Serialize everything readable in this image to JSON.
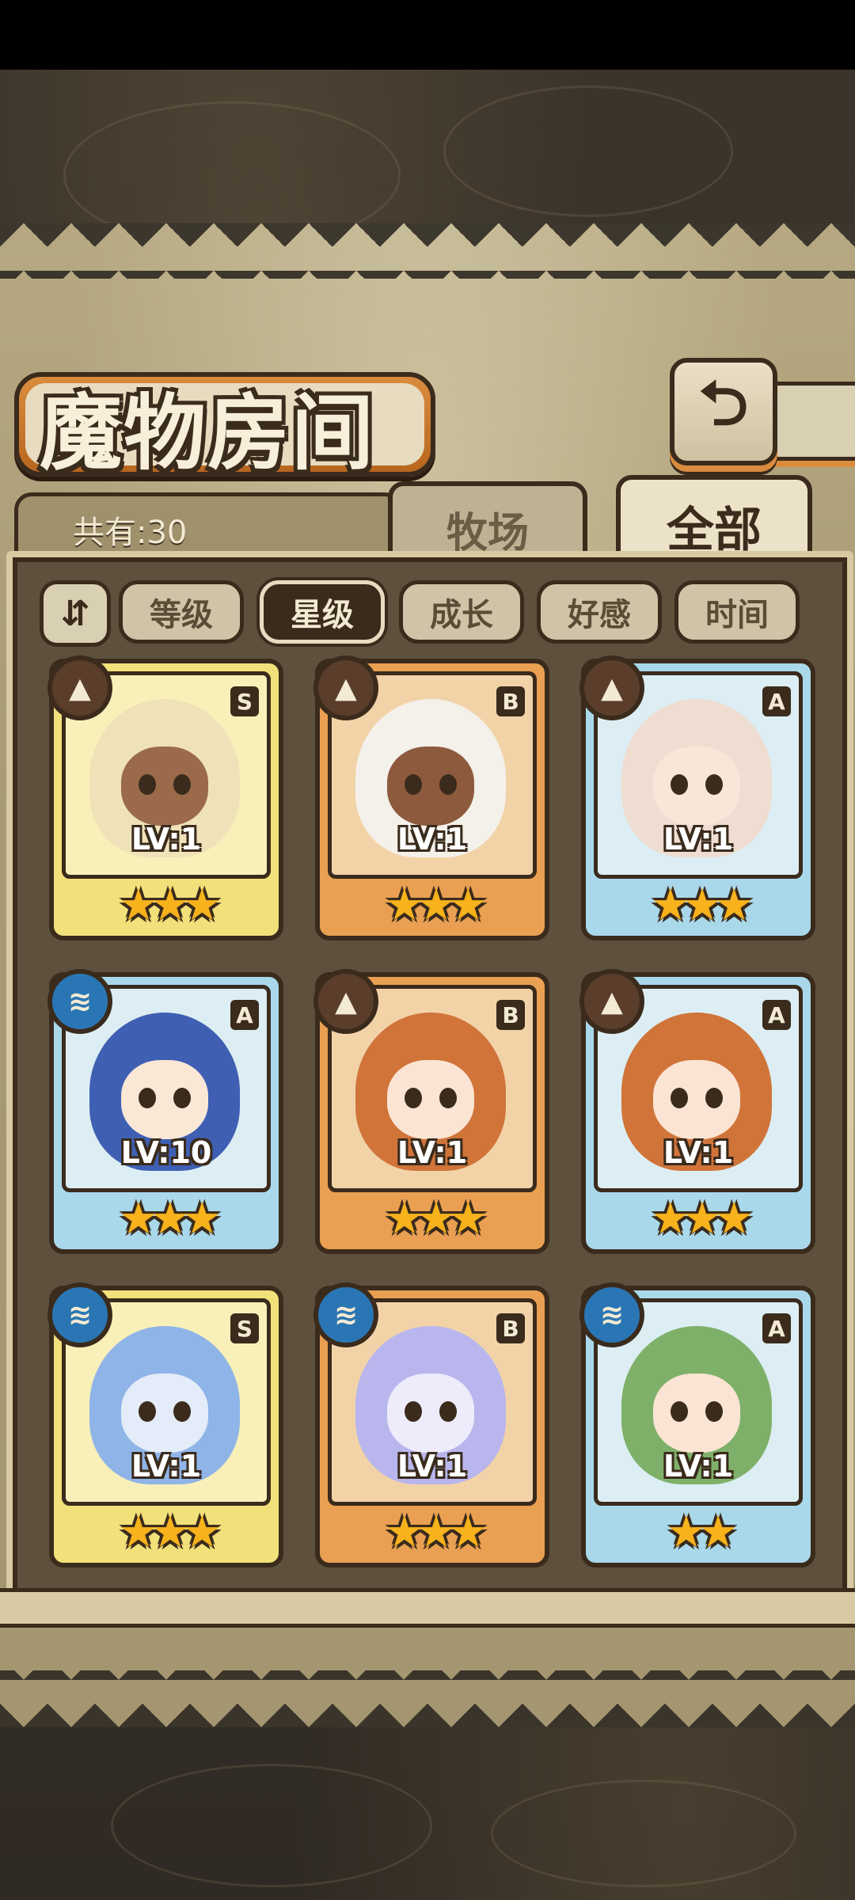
{
  "header": {
    "title": "魔物房间",
    "back_icon": "back-arrow-icon"
  },
  "summary": {
    "count_text": "共有:30"
  },
  "tabs": [
    {
      "label": "牧场",
      "selected": false
    },
    {
      "label": "全部",
      "selected": true
    }
  ],
  "sort": {
    "toggle_icon": "sort-toggle-icon",
    "options": [
      {
        "label": "等级",
        "active": false
      },
      {
        "label": "星级",
        "active": true
      },
      {
        "label": "成长",
        "active": false
      },
      {
        "label": "好感",
        "active": false
      },
      {
        "label": "时间",
        "active": false
      }
    ]
  },
  "monsters": [
    {
      "level": "LV:1",
      "rank": "S",
      "element": "earth",
      "stars": 3,
      "frame": "gold",
      "hair": "#efe2b8",
      "skin": "#9a6a4b"
    },
    {
      "level": "LV:1",
      "rank": "B",
      "element": "earth",
      "stars": 3,
      "frame": "bronze",
      "hair": "#f4f0ea",
      "skin": "#8d5a3d"
    },
    {
      "level": "LV:1",
      "rank": "A",
      "element": "earth",
      "stars": 3,
      "frame": "blue",
      "hair": "#eeddd0",
      "skin": "#f8e6d8"
    },
    {
      "level": "LV:10",
      "rank": "A",
      "element": "water",
      "stars": 3,
      "frame": "blue",
      "hair": "#3f5fb3",
      "skin": "#fbe7d6"
    },
    {
      "level": "LV:1",
      "rank": "B",
      "element": "earth",
      "stars": 3,
      "frame": "bronze",
      "hair": "#d0743a",
      "skin": "#fbe4d3"
    },
    {
      "level": "LV:1",
      "rank": "A",
      "element": "earth",
      "stars": 3,
      "frame": "blue",
      "hair": "#d0743a",
      "skin": "#fbe4d3"
    },
    {
      "level": "LV:1",
      "rank": "S",
      "element": "water",
      "stars": 3,
      "frame": "gold",
      "hair": "#8fb4e8",
      "skin": "#e3ecf8"
    },
    {
      "level": "LV:1",
      "rank": "B",
      "element": "water",
      "stars": 3,
      "frame": "bronze",
      "hair": "#b9b6ee",
      "skin": "#eeecfb"
    },
    {
      "level": "LV:1",
      "rank": "A",
      "element": "water",
      "stars": 2,
      "frame": "blue",
      "hair": "#7fb06a",
      "skin": "#fbe4d3"
    }
  ],
  "element_icons": {
    "earth": "mountain-icon",
    "water": "water-wave-icon"
  },
  "colors": {
    "gold_frame": "#f2e07a",
    "bronze_frame": "#e9a052",
    "blue_frame": "#a9d8ea",
    "star": "#f7b21c",
    "outline": "#3a2b1c"
  }
}
